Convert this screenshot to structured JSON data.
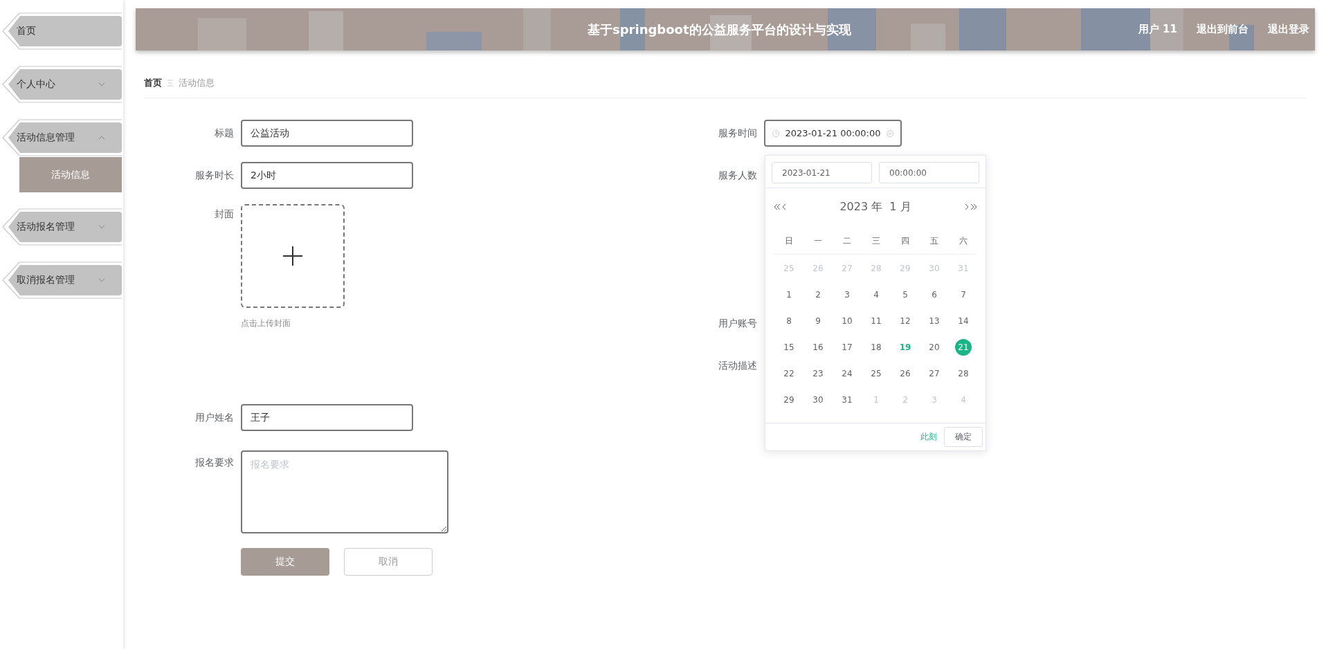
{
  "sidebar": {
    "items": [
      {
        "label": "首页",
        "kind": "link"
      },
      {
        "label": "个人中心",
        "kind": "menu",
        "expanded": false
      },
      {
        "label": "活动信息管理",
        "kind": "menu",
        "expanded": true,
        "children": [
          {
            "label": "活动信息",
            "selected": true
          }
        ]
      },
      {
        "label": "活动报名管理",
        "kind": "menu",
        "expanded": false
      },
      {
        "label": "取消报名管理",
        "kind": "menu",
        "expanded": false
      }
    ]
  },
  "header": {
    "title": "基于springboot的公益服务平台的设计与实现",
    "links": [
      "用户 11",
      "退出到前台",
      "退出登录"
    ]
  },
  "breadcrumb": {
    "items": [
      "首页",
      "活动信息"
    ]
  },
  "form": {
    "left": [
      {
        "kind": "text",
        "label": "标题",
        "value": "公益活动"
      },
      {
        "kind": "text",
        "label": "服务时长",
        "value": "2小时"
      },
      {
        "kind": "upload",
        "label": "封面",
        "hint": "点击上传封面"
      },
      {
        "kind": "text",
        "label": "用户姓名",
        "value": "王子"
      },
      {
        "kind": "textarea",
        "label": "报名要求",
        "placeholder": "报名要求"
      }
    ],
    "right": [
      {
        "kind": "datetime",
        "label": "服务时间",
        "value": "2023-01-21 00:00:00"
      },
      {
        "kind": "label",
        "label": "服务人数"
      },
      {
        "kind": "label",
        "label": "用户账号"
      },
      {
        "kind": "label",
        "label": "活动描述"
      }
    ],
    "buttons": [
      {
        "kind": "primary",
        "label": "提交"
      },
      {
        "kind": "plain",
        "label": "取消"
      }
    ]
  },
  "date_picker": {
    "date": "2023-01-21",
    "time": "00:00:00",
    "title": "2023 年  1 月",
    "weekdays": [
      "日",
      "一",
      "二",
      "三",
      "四",
      "五",
      "六"
    ],
    "weeks": [
      [
        {
          "day": "25",
          "muted": true,
          "today": false,
          "selected": false
        },
        {
          "day": "26",
          "muted": true,
          "today": false,
          "selected": false
        },
        {
          "day": "27",
          "muted": true,
          "today": false,
          "selected": false
        },
        {
          "day": "28",
          "muted": true,
          "today": false,
          "selected": false
        },
        {
          "day": "29",
          "muted": true,
          "today": false,
          "selected": false
        },
        {
          "day": "30",
          "muted": true,
          "today": false,
          "selected": false
        },
        {
          "day": "31",
          "muted": true,
          "today": false,
          "selected": false
        }
      ],
      [
        {
          "day": "1",
          "muted": false,
          "today": false,
          "selected": false
        },
        {
          "day": "2",
          "muted": false,
          "today": false,
          "selected": false
        },
        {
          "day": "3",
          "muted": false,
          "today": false,
          "selected": false
        },
        {
          "day": "4",
          "muted": false,
          "today": false,
          "selected": false
        },
        {
          "day": "5",
          "muted": false,
          "today": false,
          "selected": false
        },
        {
          "day": "6",
          "muted": false,
          "today": false,
          "selected": false
        },
        {
          "day": "7",
          "muted": false,
          "today": false,
          "selected": false
        }
      ],
      [
        {
          "day": "8",
          "muted": false,
          "today": false,
          "selected": false
        },
        {
          "day": "9",
          "muted": false,
          "today": false,
          "selected": false
        },
        {
          "day": "10",
          "muted": false,
          "today": false,
          "selected": false
        },
        {
          "day": "11",
          "muted": false,
          "today": false,
          "selected": false
        },
        {
          "day": "12",
          "muted": false,
          "today": false,
          "selected": false
        },
        {
          "day": "13",
          "muted": false,
          "today": false,
          "selected": false
        },
        {
          "day": "14",
          "muted": false,
          "today": false,
          "selected": false
        }
      ],
      [
        {
          "day": "15",
          "muted": false,
          "today": false,
          "selected": false
        },
        {
          "day": "16",
          "muted": false,
          "today": false,
          "selected": false
        },
        {
          "day": "17",
          "muted": false,
          "today": false,
          "selected": false
        },
        {
          "day": "18",
          "muted": false,
          "today": false,
          "selected": false
        },
        {
          "day": "19",
          "muted": false,
          "today": true,
          "selected": false
        },
        {
          "day": "20",
          "muted": false,
          "today": false,
          "selected": false
        },
        {
          "day": "21",
          "muted": false,
          "today": false,
          "selected": true
        }
      ],
      [
        {
          "day": "22",
          "muted": false,
          "today": false,
          "selected": false
        },
        {
          "day": "23",
          "muted": false,
          "today": false,
          "selected": false
        },
        {
          "day": "24",
          "muted": false,
          "today": false,
          "selected": false
        },
        {
          "day": "25",
          "muted": false,
          "today": false,
          "selected": false
        },
        {
          "day": "26",
          "muted": false,
          "today": false,
          "selected": false
        },
        {
          "day": "27",
          "muted": false,
          "today": false,
          "selected": false
        },
        {
          "day": "28",
          "muted": false,
          "today": false,
          "selected": false
        }
      ],
      [
        {
          "day": "29",
          "muted": false,
          "today": false,
          "selected": false
        },
        {
          "day": "30",
          "muted": false,
          "today": false,
          "selected": false
        },
        {
          "day": "31",
          "muted": false,
          "today": false,
          "selected": false
        },
        {
          "day": "1",
          "muted": true,
          "today": false,
          "selected": false
        },
        {
          "day": "2",
          "muted": true,
          "today": false,
          "selected": false
        },
        {
          "day": "3",
          "muted": true,
          "today": false,
          "selected": false
        },
        {
          "day": "4",
          "muted": true,
          "today": false,
          "selected": false
        }
      ]
    ],
    "now_button": "此刻",
    "ok_button": "确定"
  }
}
